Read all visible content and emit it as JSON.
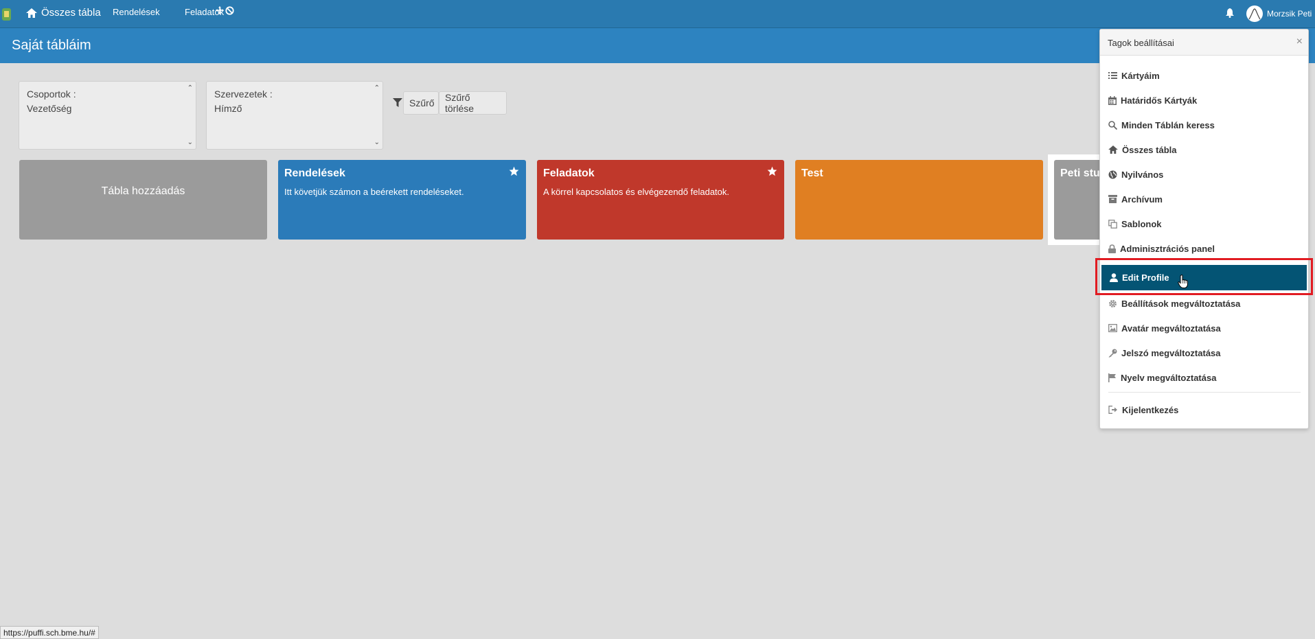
{
  "nav": {
    "home_label": "Összes tábla",
    "links": [
      "Rendelések",
      "Feladatok"
    ],
    "user_name": "Morzsik Peti"
  },
  "page": {
    "title": "Saját tábláim"
  },
  "filters": {
    "groups": {
      "label": "Csoportok :",
      "value": "Vezetőség"
    },
    "orgs": {
      "label": "Szervezetek :",
      "value": "Hímző"
    },
    "filter_button": "Szűrő",
    "clear_button": "Szűrő törlése"
  },
  "boards": [
    {
      "title": "Tábla hozzáadás",
      "color": "#9b9b9b"
    },
    {
      "title": "Rendelések",
      "description": "Itt követjük számon a beérekett rendeléseket.",
      "color": "#2b7bb9",
      "starred": true
    },
    {
      "title": "Feladatok",
      "description": "A körrel kapcsolatos és elvégezendő feladatok.",
      "color": "#c0382b",
      "starred": true
    },
    {
      "title": "Test",
      "color": "#e07f22"
    },
    {
      "title": "Peti stu",
      "color": "#9b9b9b"
    }
  ],
  "dropdown": {
    "title": "Tagok beállításai",
    "items": [
      {
        "label": "Kártyáim",
        "icon": "list-icon"
      },
      {
        "label": "Határidős Kártyák",
        "icon": "calendar-icon"
      },
      {
        "label": "Minden Táblán keress",
        "icon": "search-icon"
      },
      {
        "label": "Összes tábla",
        "icon": "home-icon"
      },
      {
        "label": "Nyilvános",
        "icon": "globe-icon"
      },
      {
        "label": "Archívum",
        "icon": "archive-icon"
      },
      {
        "label": "Sablonok",
        "icon": "copy-icon"
      },
      {
        "label": "Adminisztrációs panel",
        "icon": "lock-icon"
      },
      {
        "label": "Edit Profile",
        "icon": "user-icon"
      },
      {
        "label": "Beállítások megváltoztatása",
        "icon": "gear-icon"
      },
      {
        "label": "Avatár megváltoztatása",
        "icon": "image-icon"
      },
      {
        "label": "Jelszó megváltoztatása",
        "icon": "key-icon"
      },
      {
        "label": "Nyelv megváltoztatása",
        "icon": "flag-icon"
      },
      {
        "label": "Kijelentkezés",
        "icon": "sign-out-icon"
      }
    ]
  },
  "status_bar": {
    "url": "https://puffi.sch.bme.hu/#"
  },
  "colors": {
    "nav": "#2a7ab0",
    "header": "#2d83c0",
    "active_item": "#045474",
    "highlight": "#e11b22"
  }
}
